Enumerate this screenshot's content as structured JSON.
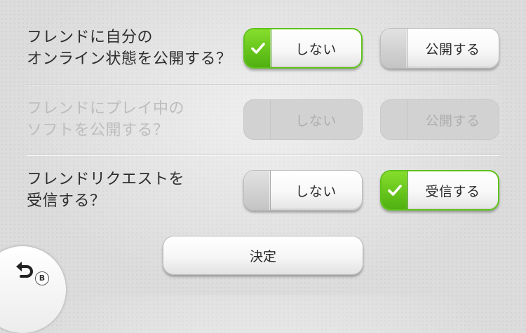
{
  "settings": [
    {
      "label_line1": "フレンドに自分の",
      "label_line2": "オンライン状態を公開する？",
      "options": [
        {
          "label": "しない",
          "selected": true
        },
        {
          "label": "公開する",
          "selected": false
        }
      ],
      "disabled": false
    },
    {
      "label_line1": "フレンドにプレイ中の",
      "label_line2": "ソフトを公開する？",
      "options": [
        {
          "label": "しない",
          "selected": false
        },
        {
          "label": "公開する",
          "selected": false
        }
      ],
      "disabled": true
    },
    {
      "label_line1": "フレンドリクエストを",
      "label_line2": "受信する？",
      "options": [
        {
          "label": "しない",
          "selected": false
        },
        {
          "label": "受信する",
          "selected": true
        }
      ],
      "disabled": false
    }
  ],
  "confirm_button": {
    "label": "決定"
  },
  "back": {
    "icon": "back-arrow-icon",
    "button_hint": "B"
  },
  "colors": {
    "check_green": "#5ec21a",
    "text": "#2e2e2e",
    "disabled_text": "#bdbdbd"
  }
}
